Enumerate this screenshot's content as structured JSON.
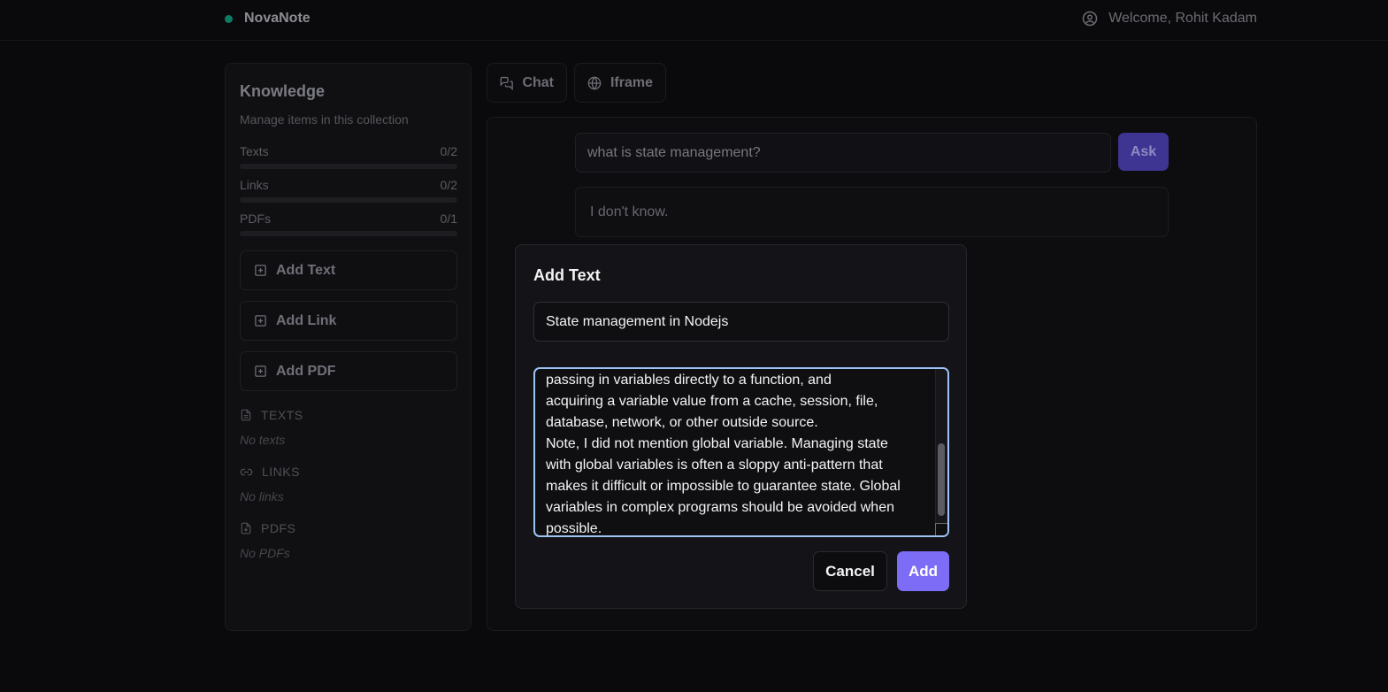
{
  "header": {
    "brand": "NovaNote",
    "welcome": "Welcome, Rohit Kadam",
    "brand_dot_color": "#10a37f"
  },
  "sidebar": {
    "title": "Knowledge",
    "subtitle": "Manage items in this collection",
    "counters": [
      {
        "label": "Texts",
        "value": "0/2",
        "progress": 0
      },
      {
        "label": "Links",
        "value": "0/2",
        "progress": 0
      },
      {
        "label": "PDFs",
        "value": "0/1",
        "progress": 0
      }
    ],
    "buttons": {
      "add_text": "Add Text",
      "add_link": "Add Link",
      "add_pdf": "Add PDF"
    },
    "sections": {
      "texts": {
        "heading": "TEXTS",
        "empty": "No texts"
      },
      "links": {
        "heading": "LINKS",
        "empty": "No links"
      },
      "pdfs": {
        "heading": "PDFS",
        "empty": "No PDFs"
      }
    }
  },
  "tabs": {
    "chat": "Chat",
    "iframe": "Iframe"
  },
  "chat": {
    "question": "what is state management?",
    "ask_label": "Ask",
    "answer": "I don't know."
  },
  "modal": {
    "title": "Add Text",
    "title_value": "State management in Nodejs",
    "content_value": "passing in variables directly to a function, and\nacquiring a variable value from a cache, session, file,\ndatabase, network, or other outside source.\nNote, I did not mention global variable. Managing state\nwith global variables is often a sloppy anti-pattern that\nmakes it difficult or impossible to guarantee state. Global\nvariables in complex programs should be avoided when\npossible.",
    "cancel_label": "Cancel",
    "add_label": "Add"
  },
  "colors": {
    "accent": "#7c6cf6",
    "focus_ring": "#9cc4f4",
    "background": "#0a0a0c"
  }
}
